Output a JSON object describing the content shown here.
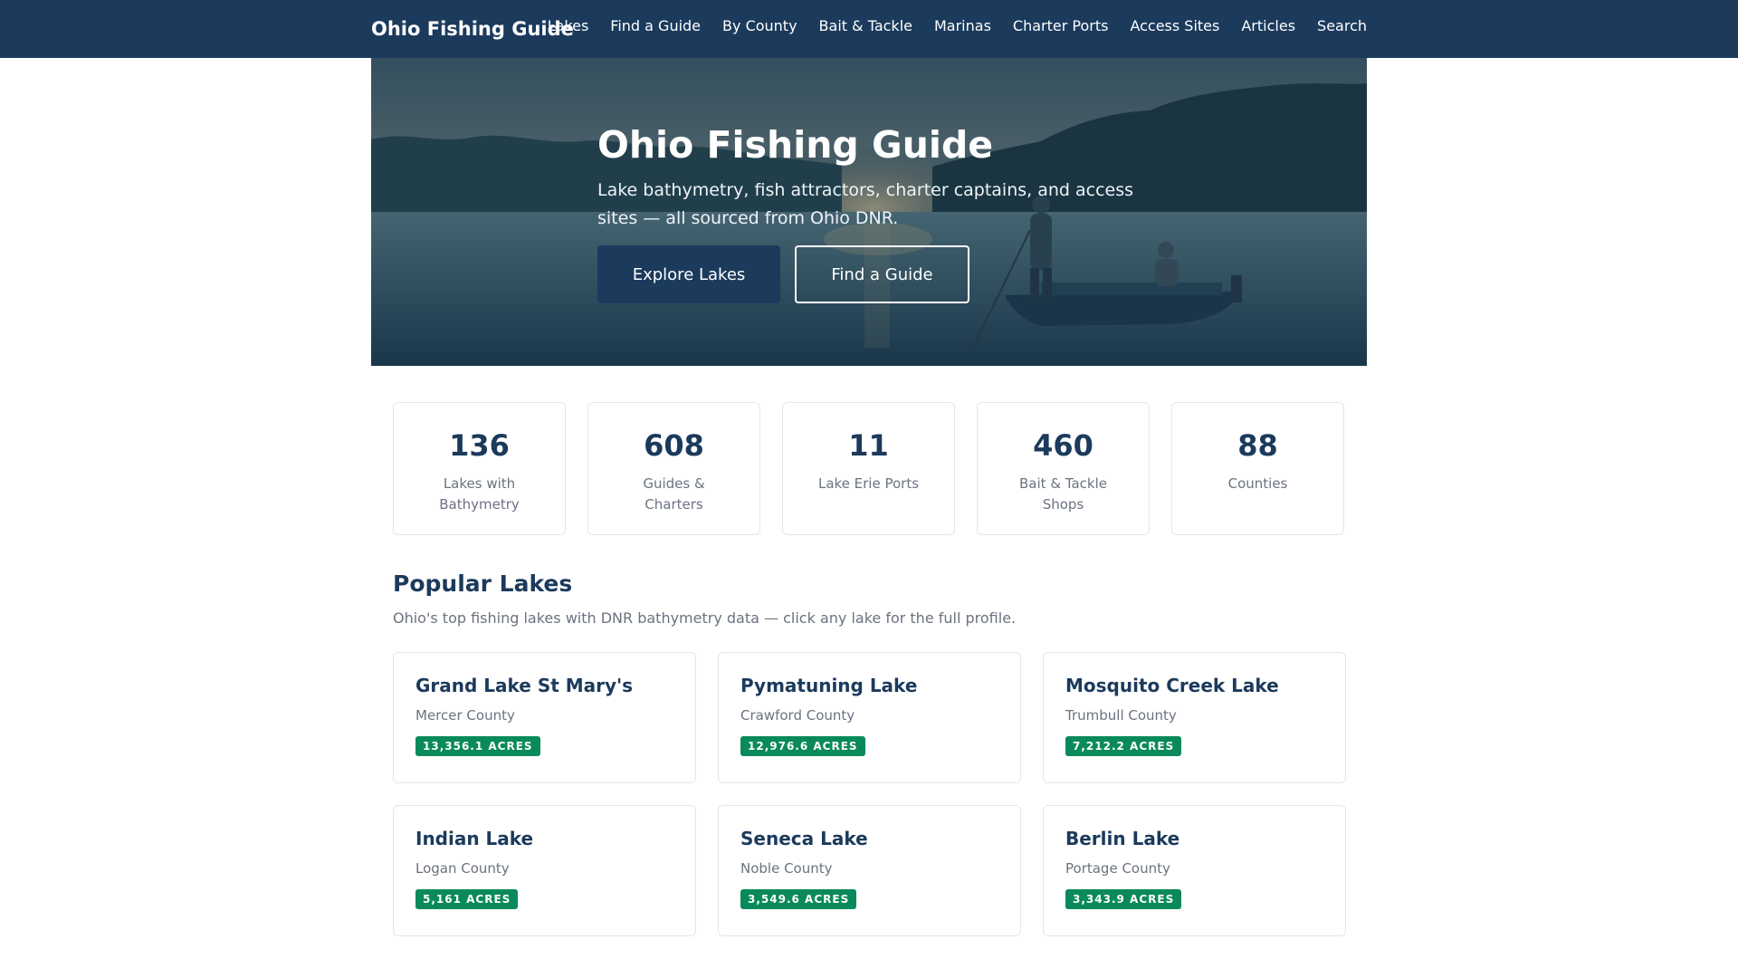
{
  "nav": {
    "brand": "Ohio Fishing Guide",
    "links": [
      "Lakes",
      "Find a Guide",
      "By County",
      "Bait & Tackle",
      "Marinas",
      "Charter Ports",
      "Access Sites",
      "Articles",
      "Search"
    ]
  },
  "hero": {
    "title": "Ohio Fishing Guide",
    "subtitle": "Lake bathymetry, fish attractors, charter captains, and access sites — all sourced from Ohio DNR.",
    "primary_button": "Explore Lakes",
    "secondary_button": "Find a Guide"
  },
  "stats": [
    {
      "value": "136",
      "label": "Lakes with Bathymetry"
    },
    {
      "value": "608",
      "label": "Guides & Charters"
    },
    {
      "value": "11",
      "label": "Lake Erie Ports"
    },
    {
      "value": "460",
      "label": "Bait & Tackle Shops"
    },
    {
      "value": "88",
      "label": "Counties"
    }
  ],
  "popular": {
    "title": "Popular Lakes",
    "subtitle": "Ohio's top fishing lakes with DNR bathymetry data — click any lake for the full profile.",
    "lakes": [
      {
        "name": "Grand Lake St Mary's",
        "county": "Mercer County",
        "acres": "13,356.1 ACRES"
      },
      {
        "name": "Pymatuning Lake",
        "county": "Crawford County",
        "acres": "12,976.6 ACRES"
      },
      {
        "name": "Mosquito Creek Lake",
        "county": "Trumbull County",
        "acres": "7,212.2 ACRES"
      },
      {
        "name": "Indian Lake",
        "county": "Logan County",
        "acres": "5,161 ACRES"
      },
      {
        "name": "Seneca Lake",
        "county": "Noble County",
        "acres": "3,549.6 ACRES"
      },
      {
        "name": "Berlin Lake",
        "county": "Portage County",
        "acres": "3,343.9 ACRES"
      }
    ]
  },
  "colors": {
    "navy": "#1b3a5c",
    "badge_green": "#0a8a5a",
    "muted_text": "#6b7280"
  }
}
